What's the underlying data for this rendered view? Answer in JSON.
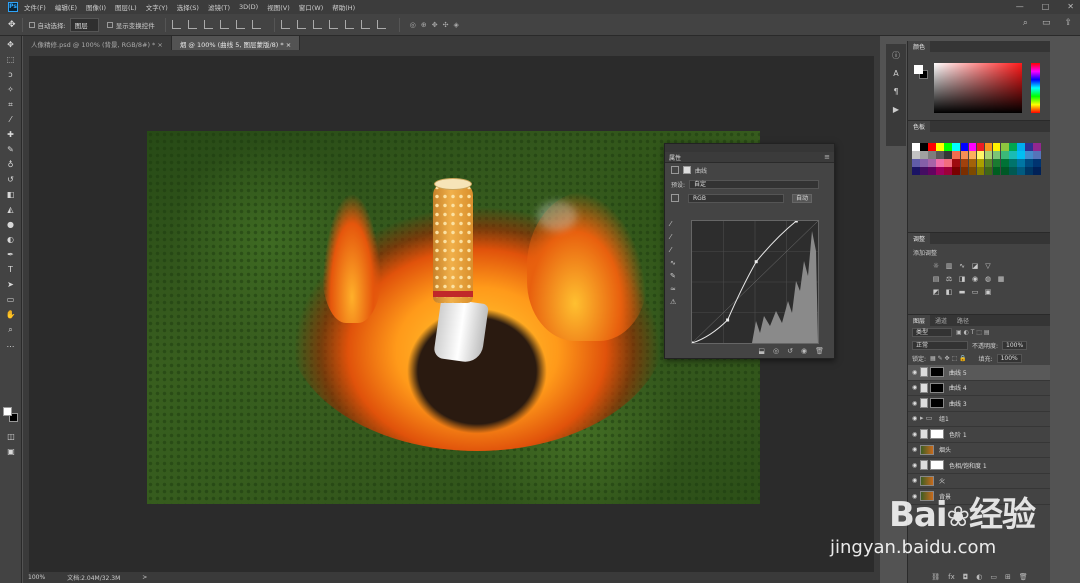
{
  "menubar": {
    "logo": "Ps",
    "items": [
      "文件(F)",
      "编辑(E)",
      "图像(I)",
      "图层(L)",
      "文字(Y)",
      "选择(S)",
      "滤镜(T)",
      "3D(D)",
      "视图(V)",
      "窗口(W)",
      "帮助(H)"
    ],
    "window_controls": [
      "—",
      "□",
      "✕"
    ]
  },
  "options": {
    "auto_select_label": "自动选择:",
    "auto_select_value": "图层",
    "show_transform_label": "显示变换控件"
  },
  "tabs": [
    {
      "label": "人像精修.psd @ 100% (背景, RGB/8#) *",
      "close": "×"
    },
    {
      "label": "烟 @ 100% (曲线 5, 图层蒙版/8) *",
      "close": "×"
    }
  ],
  "properties": {
    "title": "属性",
    "header_label": "曲线",
    "preset_label": "预设:",
    "preset_value": "自定",
    "channel_value": "RGB",
    "auto_label": "自动",
    "menu": "≡",
    "curve": {
      "points": [
        [
          0,
          0
        ],
        [
          72,
          48
        ],
        [
          130,
          170
        ],
        [
          211,
          255
        ]
      ]
    }
  },
  "right": {
    "color_tab": "颜色",
    "swatch_tab": "色板",
    "adj_tab": "调整",
    "adj_subtitle": "添加调整",
    "layers_tabs": [
      "图层",
      "通道",
      "路径"
    ],
    "filter_kind": "类型",
    "blend_mode": "正常",
    "opacity_label": "不透明度:",
    "opacity_value": "100%",
    "lock_label": "锁定:",
    "fill_label": "填充:",
    "fill_value": "100%",
    "layers": [
      {
        "name": "曲线 5",
        "selected": true,
        "thumb": "black"
      },
      {
        "name": "曲线 4",
        "selected": false,
        "thumb": "black"
      },
      {
        "name": "曲线 3",
        "selected": false,
        "thumb": "black"
      },
      {
        "name": "组1",
        "selected": false,
        "thumb": "folder"
      },
      {
        "name": "色阶 1",
        "selected": false,
        "thumb": "white"
      },
      {
        "name": "烟头",
        "selected": false,
        "thumb": "image"
      },
      {
        "name": "色相/饱和度 1",
        "selected": false,
        "thumb": "white"
      },
      {
        "name": "火",
        "selected": false,
        "thumb": "image"
      },
      {
        "name": "背景",
        "selected": false,
        "thumb": "image"
      }
    ],
    "swatch_colors": [
      "#ffffff",
      "#000000",
      "#ff0000",
      "#ffff00",
      "#00ff00",
      "#00ffff",
      "#0000ff",
      "#ff00ff",
      "#ed1c24",
      "#f7941d",
      "#fff200",
      "#8dc63f",
      "#00a651",
      "#00aeef",
      "#2e3192",
      "#92278f",
      "#c2c2c2",
      "#a0a0a0",
      "#7d7d7d",
      "#595959",
      "#363636",
      "#f26c4f",
      "#f68e55",
      "#fbaf5c",
      "#fff568",
      "#acd373",
      "#7cc576",
      "#3bb878",
      "#1abbb4",
      "#00bff3",
      "#438ccb",
      "#5574b9",
      "#605ca8",
      "#855fa8",
      "#a763a8",
      "#f06ea9",
      "#f26d7d",
      "#9e0b0f",
      "#a0410d",
      "#a36209",
      "#aba000",
      "#598527",
      "#1a7b30",
      "#007236",
      "#00746b",
      "#0076a3",
      "#004b80",
      "#003471",
      "#1b1464",
      "#440e62",
      "#630460",
      "#9e005d",
      "#9e0039",
      "#790000",
      "#7b2e00",
      "#7d4900",
      "#827b00",
      "#406618",
      "#005e20",
      "#005826",
      "#005952",
      "#005b7f",
      "#003663",
      "#002157"
    ]
  },
  "status": {
    "zoom": "100%",
    "doc": "文档:2.04M/32.3M",
    "arrow": ">"
  },
  "watermark": {
    "logo": "Bai",
    "logo2": "经验",
    "paw": "❀",
    "url": "jingyan.baidu.com"
  }
}
